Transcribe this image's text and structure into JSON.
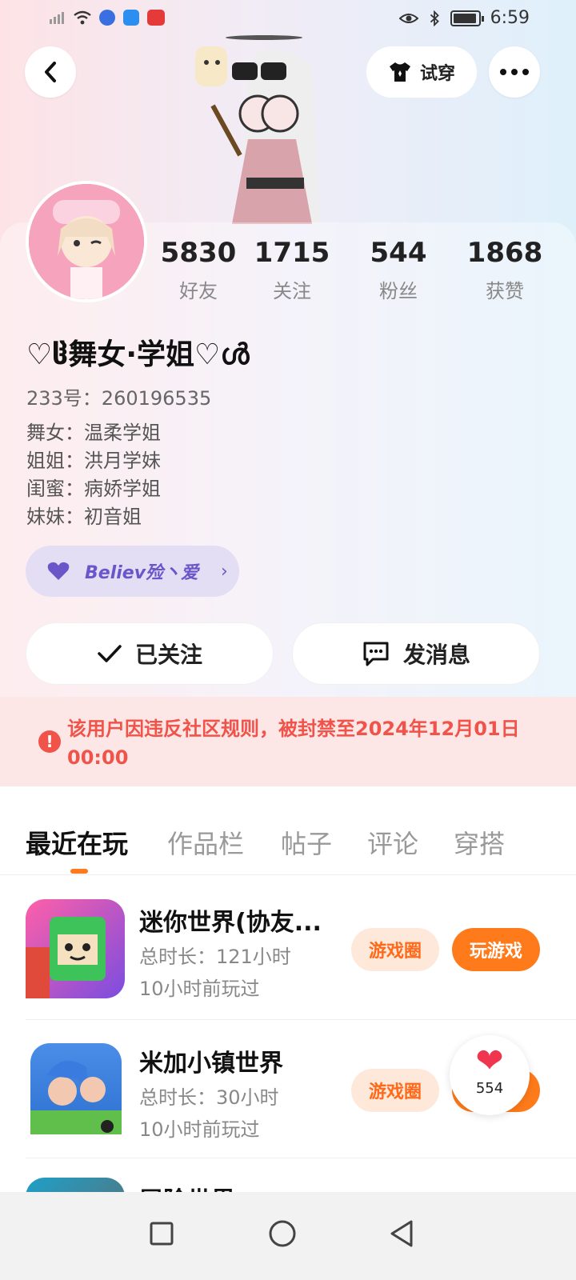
{
  "status_bar": {
    "time": "6:59"
  },
  "header": {
    "tryon_label": "试穿"
  },
  "profile": {
    "stats": [
      {
        "value": "5830",
        "label": "好友"
      },
      {
        "value": "1715",
        "label": "关注"
      },
      {
        "value": "544",
        "label": "粉丝"
      },
      {
        "value": "1868",
        "label": "获赞"
      }
    ],
    "nickname": "♡ჱ舞女·学姐♡ൾ",
    "uid": "233号：260196535",
    "bio": [
      "舞女：温柔学姐",
      "姐姐：洪月学妹",
      "闺蜜：病娇学姐",
      "妹妹：初音姐"
    ],
    "tag_label": "Believ殓丶爱",
    "tag_arrow": "›"
  },
  "actions": {
    "follow_label": "已关注",
    "message_label": "发消息"
  },
  "ban_notice": "该用户因违反社区规则，被封禁至2024年12月01日 00:00",
  "tabs": [
    "最近在玩",
    "作品栏",
    "帖子",
    "评论",
    "穿搭"
  ],
  "games": [
    {
      "title": "迷你世界(协友...",
      "duration": "总时长：121小时",
      "last_played": "10小时前玩过",
      "circle_label": "游戏圈",
      "play_label": "玩游戏"
    },
    {
      "title": "米加小镇世界",
      "duration": "总时长：30小时",
      "last_played": "10小时前玩过",
      "circle_label": "游戏圈",
      "play_label": "玩游戏"
    },
    {
      "title": "冒险世界"
    }
  ],
  "like_fab": {
    "count": "554"
  },
  "colors": {
    "accent": "#ff7a1a",
    "ban_text": "#f0534a",
    "tag_bg": "#e3def4"
  },
  "icons": [
    "back-arrow-icon",
    "tshirt-icon",
    "more-dots-icon",
    "heart-icon",
    "checkmark-icon",
    "chat-bubble-icon",
    "warning-icon"
  ]
}
